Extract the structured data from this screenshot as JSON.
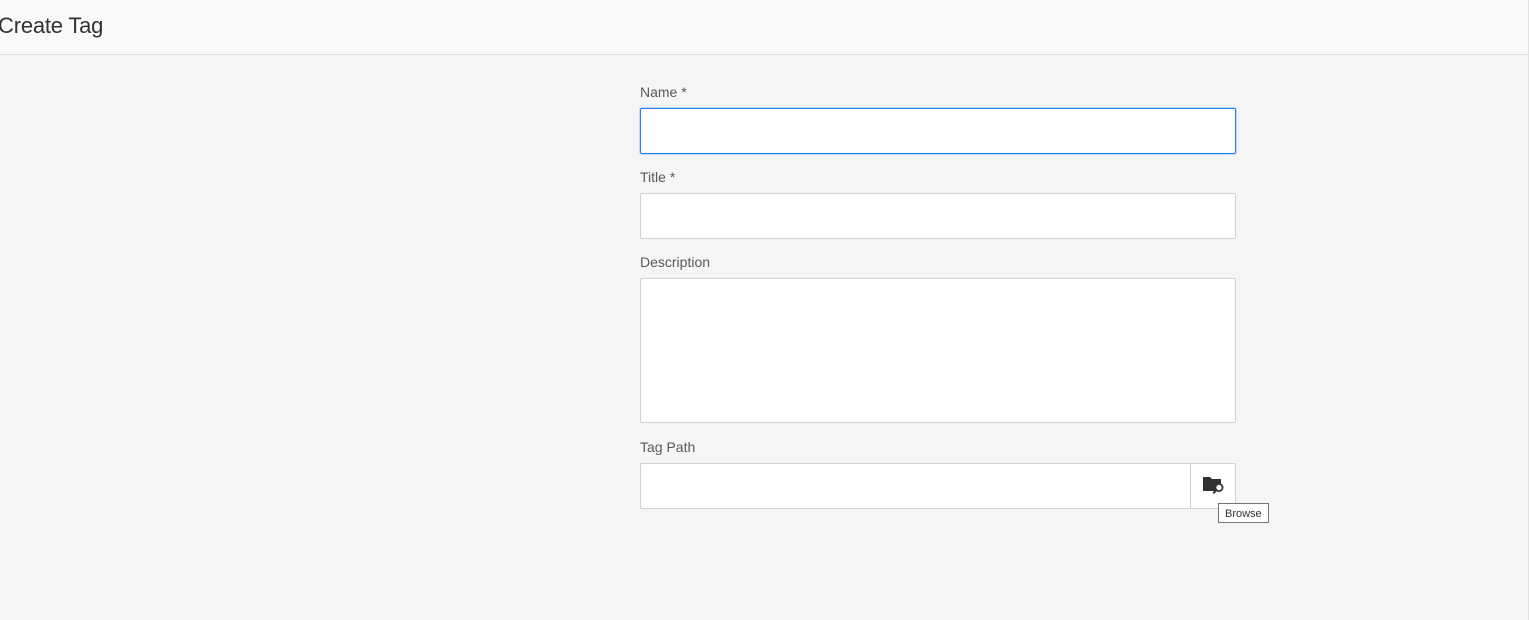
{
  "header": {
    "title": "Create Tag"
  },
  "form": {
    "name": {
      "label": "Name *",
      "value": "",
      "placeholder": ""
    },
    "title": {
      "label": "Title *",
      "value": "",
      "placeholder": ""
    },
    "description": {
      "label": "Description",
      "value": "",
      "placeholder": ""
    },
    "tag_path": {
      "label": "Tag Path",
      "value": "",
      "placeholder": ""
    }
  },
  "browse": {
    "icon": "folder-search-icon",
    "tooltip": "Browse"
  },
  "colors": {
    "background": "#f5f5f5",
    "focus_border": "#2680eb",
    "input_border": "#d0d0d0"
  }
}
